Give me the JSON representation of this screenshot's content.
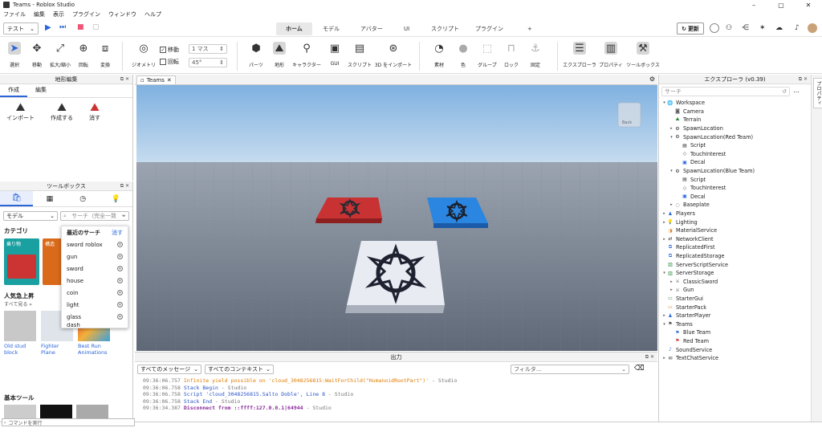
{
  "window": {
    "title": "Teams - Roblox Studio",
    "minimize": "–",
    "maximize": "▢",
    "close": "✕"
  },
  "menu": [
    "ファイル",
    "編集",
    "表示",
    "プラグイン",
    "ウィンドウ",
    "ヘルプ"
  ],
  "mode_select": "テスト",
  "ribbon_tabs": [
    {
      "label": "ホーム",
      "active": true
    },
    {
      "label": "モデル"
    },
    {
      "label": "アバター"
    },
    {
      "label": "UI"
    },
    {
      "label": "スクリプト"
    },
    {
      "label": "プラグイン"
    },
    {
      "label": "+"
    }
  ],
  "update_button": "更新",
  "tools": {
    "select": "選択",
    "move": "移動",
    "scale": "拡大/縮小",
    "rotate": "回転",
    "transform": "変換",
    "geometry": "ジオメトリ",
    "move_chk": "移動",
    "rotate_chk": "回転",
    "move_step": "1 マス",
    "rotate_step": "45°",
    "parts": "パーツ",
    "terrain": "地形",
    "character": "キャラクター",
    "gui": "GUI",
    "script": "スクリプト",
    "import3d": "3D をインポート",
    "material": "素材",
    "color": "色",
    "group": "グループ",
    "lock": "ロック",
    "anchor": "固定",
    "explorer": "エクスプローラ",
    "properties": "プロパティ",
    "toolbox": "ツールボックス"
  },
  "terrain_panel": {
    "title": "地形編集",
    "tabs": [
      "作成",
      "編集"
    ],
    "buttons": [
      "インポート",
      "作成する",
      "消す"
    ]
  },
  "toolbox": {
    "title": "ツールボックス",
    "category_select": "モデル",
    "search_placeholder": "サーチ（完全一致",
    "category_heading": "カテゴリ",
    "category_tiles": [
      "乗り物",
      "構造"
    ],
    "trending_heading": "人気急上昇",
    "see_all": "すべて見る »",
    "items": [
      {
        "name": "Old stud block"
      },
      {
        "name": "Fighter Plane"
      },
      {
        "name": "Best Run Animations"
      }
    ],
    "basic_tools_heading": "基本ツール"
  },
  "recent_search": {
    "title": "最近のサーチ",
    "clear": "消す",
    "items": [
      "sword roblox",
      "gun",
      "sword",
      "house",
      "coin",
      "light",
      "glass",
      "dash"
    ]
  },
  "viewport": {
    "tab": "Teams",
    "view_cube_label": "Back"
  },
  "output": {
    "title": "出力",
    "msg_filter": "すべてのメッセージ",
    "ctx_filter": "すべてのコンテキスト",
    "filter_placeholder": "フィルタ...",
    "logs": [
      {
        "time": "09:36:06.757",
        "text": "Infinite yield possible on 'cloud_3048256815:WaitForChild(\"HumanoidRootPart\")'",
        "kind": "warn",
        "src": "-  Studio"
      },
      {
        "time": "09:36:06.758",
        "text": "Stack Begin",
        "kind": "info",
        "src": "-  Studio"
      },
      {
        "time": "09:36:06.758",
        "text": "Script 'cloud_3048256815.Salto Doble', Line 8",
        "kind": "info",
        "src": "-  Studio"
      },
      {
        "time": "09:36:06.758",
        "text": "Stack End",
        "kind": "info",
        "src": "-  Studio"
      },
      {
        "time": "09:36:34.387",
        "text": "Disconnect from ::ffff:127.0.0.1|64944",
        "kind": "err",
        "src": "-  Studio"
      }
    ]
  },
  "explorer": {
    "title": "エクスプローラ (v0.39)",
    "search_placeholder": "サーチ",
    "tree": [
      {
        "label": "Workspace",
        "depth": 0,
        "arrow": "▾",
        "icon": "globe"
      },
      {
        "label": "Camera",
        "depth": 1,
        "arrow": "",
        "icon": "camera"
      },
      {
        "label": "Terrain",
        "depth": 1,
        "arrow": "",
        "icon": "terrain"
      },
      {
        "label": "SpawnLocation",
        "depth": 1,
        "arrow": "▸",
        "icon": "spawn"
      },
      {
        "label": "SpawnLocation(Red Team)",
        "depth": 1,
        "arrow": "▾",
        "icon": "spawn"
      },
      {
        "label": "Script",
        "depth": 2,
        "arrow": "",
        "icon": "script"
      },
      {
        "label": "TouchInterest",
        "depth": 2,
        "arrow": "",
        "icon": "touch"
      },
      {
        "label": "Decal",
        "depth": 2,
        "arrow": "",
        "icon": "decal"
      },
      {
        "label": "SpawnLocation(Blue Team)",
        "depth": 1,
        "arrow": "▾",
        "icon": "spawn"
      },
      {
        "label": "Script",
        "depth": 2,
        "arrow": "",
        "icon": "script"
      },
      {
        "label": "TouchInterest",
        "depth": 2,
        "arrow": "",
        "icon": "touch"
      },
      {
        "label": "Decal",
        "depth": 2,
        "arrow": "",
        "icon": "decal"
      },
      {
        "label": "Baseplate",
        "depth": 1,
        "arrow": "▸",
        "icon": "part"
      },
      {
        "label": "Players",
        "depth": 0,
        "arrow": "▸",
        "icon": "players"
      },
      {
        "label": "Lighting",
        "depth": 0,
        "arrow": "▸",
        "icon": "light"
      },
      {
        "label": "MaterialService",
        "depth": 0,
        "arrow": "",
        "icon": "material"
      },
      {
        "label": "NetworkClient",
        "depth": 0,
        "arrow": "▸",
        "icon": "network"
      },
      {
        "label": "ReplicatedFirst",
        "depth": 0,
        "arrow": "",
        "icon": "repl"
      },
      {
        "label": "ReplicatedStorage",
        "depth": 0,
        "arrow": "",
        "icon": "repl"
      },
      {
        "label": "ServerScriptService",
        "depth": 0,
        "arrow": "",
        "icon": "sss"
      },
      {
        "label": "ServerStorage",
        "depth": 0,
        "arrow": "▾",
        "icon": "ss"
      },
      {
        "label": "ClassicSword",
        "depth": 1,
        "arrow": "▸",
        "icon": "tool"
      },
      {
        "label": "Gun",
        "depth": 1,
        "arrow": "▸",
        "icon": "tool"
      },
      {
        "label": "StarterGui",
        "depth": 0,
        "arrow": "",
        "icon": "gui"
      },
      {
        "label": "StarterPack",
        "depth": 0,
        "arrow": "",
        "icon": "pack"
      },
      {
        "label": "StarterPlayer",
        "depth": 0,
        "arrow": "▸",
        "icon": "player"
      },
      {
        "label": "Teams",
        "depth": 0,
        "arrow": "▾",
        "icon": "teams"
      },
      {
        "label": "Blue Team",
        "depth": 1,
        "arrow": "",
        "icon": "team-blue"
      },
      {
        "label": "Red Team",
        "depth": 1,
        "arrow": "",
        "icon": "team-red"
      },
      {
        "label": "SoundService",
        "depth": 0,
        "arrow": "",
        "icon": "sound"
      },
      {
        "label": "TextChatService",
        "depth": 0,
        "arrow": "▸",
        "icon": "chat"
      }
    ]
  },
  "right_sidebar_tab": "プロパティ",
  "command_bar_placeholder": "コマンドを実行"
}
